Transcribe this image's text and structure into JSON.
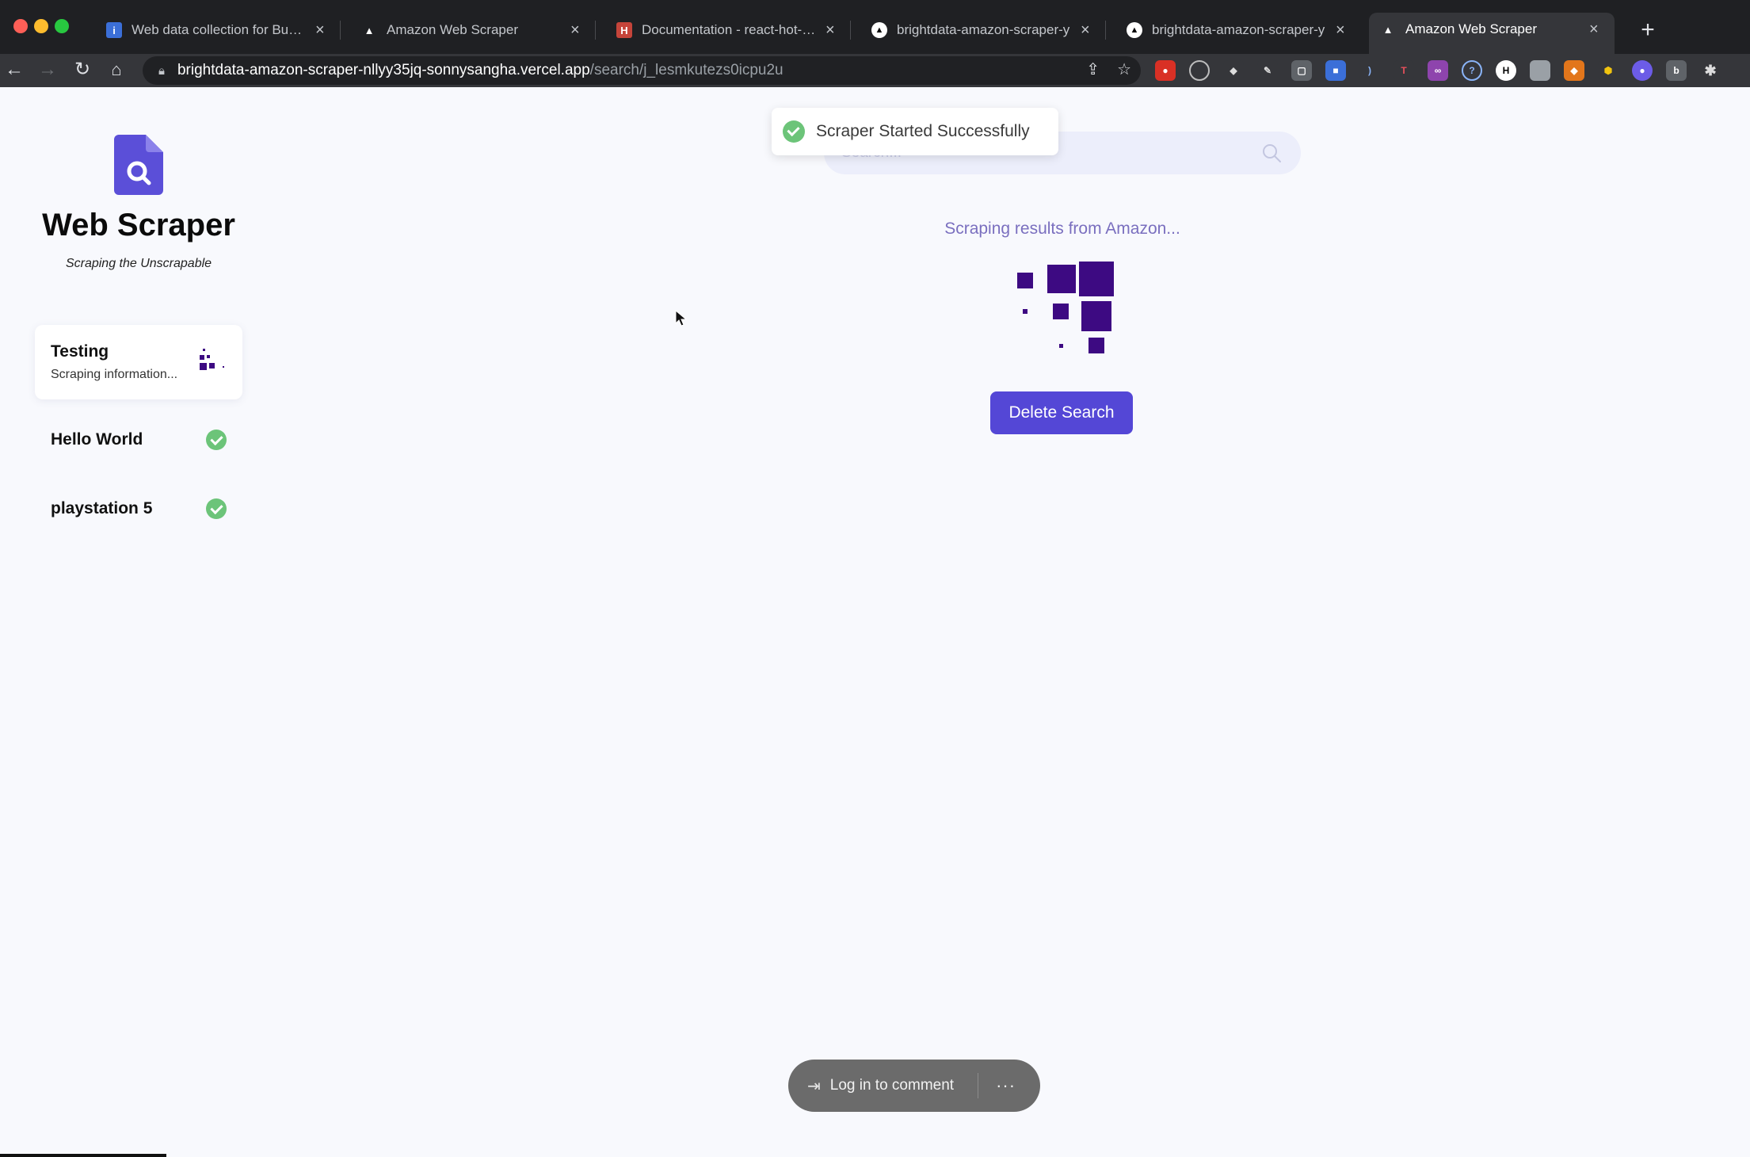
{
  "browser": {
    "tabs": [
      {
        "title": "Web data collection for Busine",
        "favicon": "bright-data-icon",
        "color": "#3b6fd8",
        "glyph": "i"
      },
      {
        "title": "Amazon Web Scraper",
        "favicon": "vercel-icon",
        "color": "#1f2023",
        "glyph": "▲"
      },
      {
        "title": "Documentation - react-hot-toa",
        "favicon": "react-hot-toast-icon",
        "color": "#c5443a",
        "glyph": "H"
      },
      {
        "title": "brightdata-amazon-scraper-y",
        "favicon": "vercel-icon",
        "color": "#ffffff",
        "glyph": "▲"
      },
      {
        "title": "brightdata-amazon-scraper-y",
        "favicon": "vercel-icon",
        "color": "#ffffff",
        "glyph": "▲"
      },
      {
        "title": "Amazon Web Scraper",
        "favicon": "vercel-icon",
        "color": "#1f2023",
        "glyph": "▲"
      }
    ],
    "active_tab": 5,
    "url_host": "brightdata-amazon-scraper-nllyy35jq-sonnysangha.vercel.app",
    "url_path": "/search/j_lesmkutezs0icpu2u"
  },
  "sidebar": {
    "app_title": "Web Scraper",
    "tagline": "Scraping the Unscrapable",
    "searches": [
      {
        "title": "Testing",
        "subtitle": "Scraping information...",
        "status": "pending"
      },
      {
        "title": "Hello World",
        "subtitle": "",
        "status": "complete"
      },
      {
        "title": "playstation 5",
        "subtitle": "",
        "status": "complete"
      }
    ]
  },
  "main": {
    "search_placeholder": "Search...",
    "toast_message": "Scraper Started Successfully",
    "status_text": "Scraping results from Amazon...",
    "delete_button": "Delete Search"
  },
  "comment_bar": {
    "login_label": "Log in to comment",
    "more_label": "···"
  },
  "colors": {
    "accent": "#5447d6",
    "loader": "#3d0a82",
    "success": "#6cc479",
    "status_text": "#7a6fbf"
  }
}
